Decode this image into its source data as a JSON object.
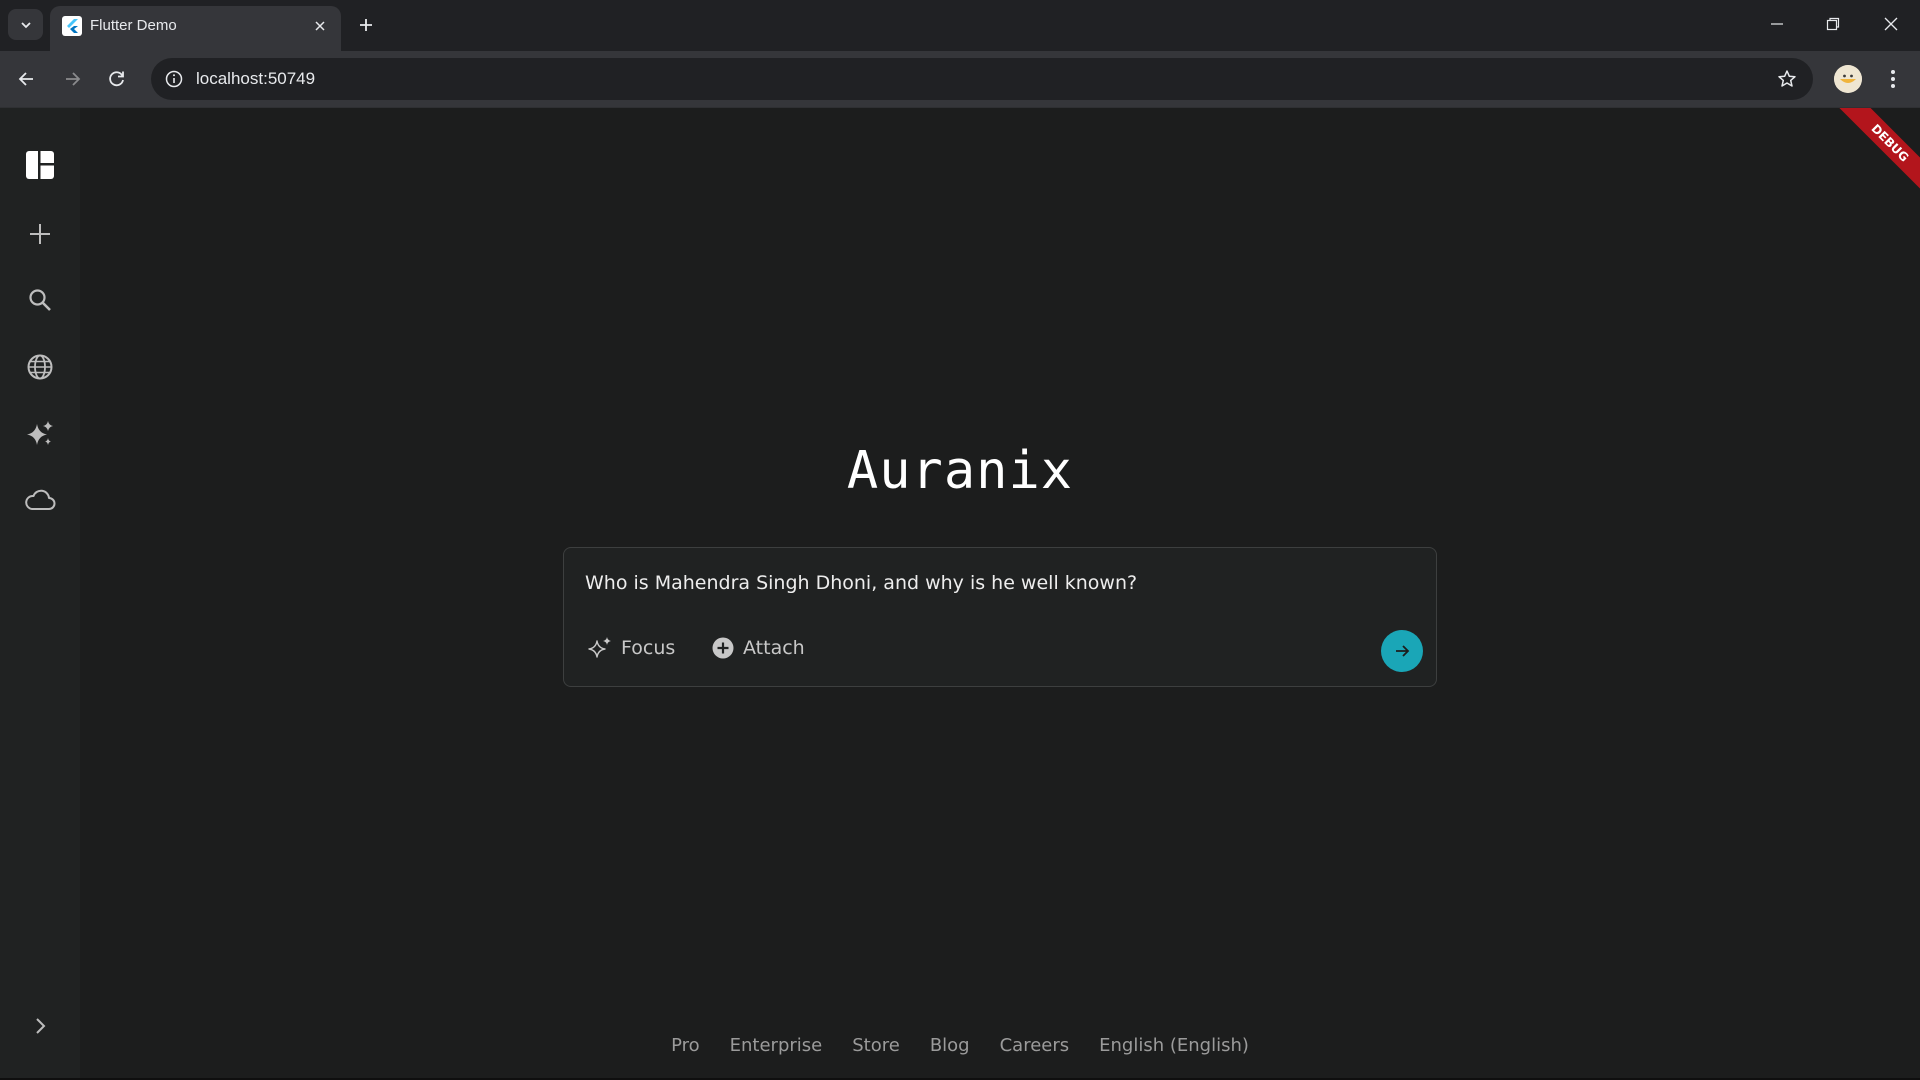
{
  "browser": {
    "tab_title": "Flutter Demo",
    "url": "localhost:50749",
    "icons": {
      "tab_search": "chevron-down-icon",
      "favicon": "flutter-icon",
      "tab_close": "close-icon",
      "new_tab": "plus-icon",
      "minimize": "minimize-icon",
      "restore": "restore-icon",
      "close_window": "close-icon",
      "back": "arrow-left-icon",
      "forward": "arrow-right-icon",
      "reload": "reload-icon",
      "site_info": "info-icon",
      "bookmark": "star-icon",
      "profile": "avatar",
      "menu": "kebab-icon"
    }
  },
  "sidebar": {
    "items": [
      {
        "name": "dashboard",
        "icon": "dashboard-icon"
      },
      {
        "name": "new-thread",
        "icon": "plus-icon"
      },
      {
        "name": "search",
        "icon": "search-icon"
      },
      {
        "name": "discover",
        "icon": "globe-icon"
      },
      {
        "name": "spaces",
        "icon": "sparkles-icon"
      },
      {
        "name": "cloud",
        "icon": "cloud-icon"
      }
    ],
    "expand_icon": "chevron-right-icon"
  },
  "main": {
    "brand": "Auranix",
    "query": "Who is Mahendra Singh Dhoni, and why is he well known?",
    "focus_label": "Focus",
    "attach_label": "Attach",
    "submit_icon": "arrow-right-icon"
  },
  "footer": {
    "links": [
      "Pro",
      "Enterprise",
      "Store",
      "Blog",
      "Careers",
      "English (English)"
    ]
  },
  "debug_banner": "DEBUG",
  "colors": {
    "accent": "#1aa6b7",
    "background": "#1c1d1d",
    "sidebar": "#202222",
    "debug": "#b3151c"
  }
}
